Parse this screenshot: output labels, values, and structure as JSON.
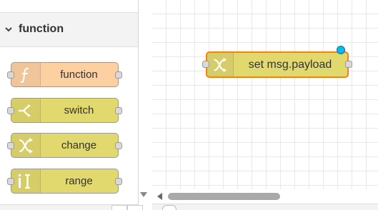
{
  "palette": {
    "category": {
      "label": "function",
      "icon": "chevron-down-icon"
    },
    "nodes": [
      {
        "label": "function",
        "icon": "function-icon",
        "color": "#fdd0a2"
      },
      {
        "label": "switch",
        "icon": "switch-icon",
        "color": "#e2d96e"
      },
      {
        "label": "change",
        "icon": "change-icon",
        "color": "#e2d96e"
      },
      {
        "label": "range",
        "icon": "range-icon",
        "color": "#e2d96e"
      }
    ]
  },
  "workspace": {
    "node": {
      "label": "set msg.payload",
      "icon": "change-icon",
      "color": "#e2d96e",
      "selected_border": "#ff7f0e",
      "changed_indicator": "#00bcf2"
    }
  }
}
